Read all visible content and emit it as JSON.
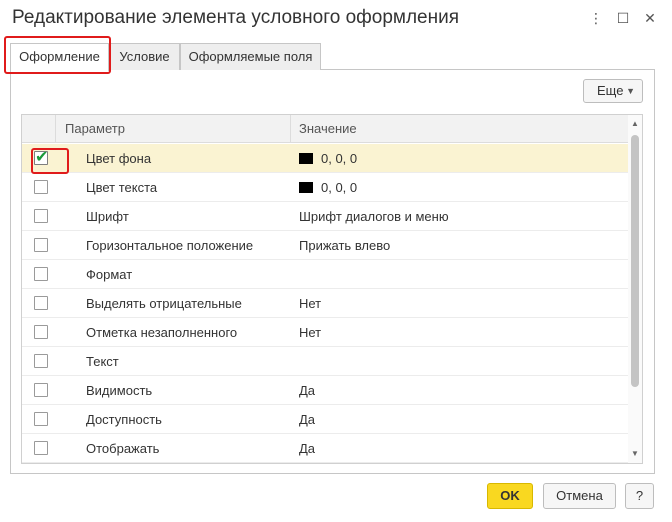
{
  "window": {
    "title": "Редактирование элемента условного оформления",
    "more_icon": "⋮",
    "maximize_icon": "☐",
    "close_icon": "✕"
  },
  "tabs": [
    {
      "label": "Оформление",
      "active": true
    },
    {
      "label": "Условие",
      "active": false
    },
    {
      "label": "Оформляемые поля",
      "active": false
    }
  ],
  "toolbar": {
    "more_label": "Еще",
    "more_caret": "▼"
  },
  "grid": {
    "columns": {
      "parameter": "Параметр",
      "value": "Значение"
    },
    "rows": [
      {
        "checked": true,
        "name": "Цвет фона",
        "value": "0, 0, 0",
        "swatch": "#000000"
      },
      {
        "checked": false,
        "name": "Цвет текста",
        "value": "0, 0, 0",
        "swatch": "#000000"
      },
      {
        "checked": false,
        "name": "Шрифт",
        "value": "Шрифт диалогов и меню"
      },
      {
        "checked": false,
        "name": "Горизонтальное положение",
        "value": "Прижать влево"
      },
      {
        "checked": false,
        "name": "Формат",
        "value": ""
      },
      {
        "checked": false,
        "name": "Выделять отрицательные",
        "value": "Нет"
      },
      {
        "checked": false,
        "name": "Отметка незаполненного",
        "value": "Нет"
      },
      {
        "checked": false,
        "name": "Текст",
        "value": ""
      },
      {
        "checked": false,
        "name": "Видимость",
        "value": "Да"
      },
      {
        "checked": false,
        "name": "Доступность",
        "value": "Да"
      },
      {
        "checked": false,
        "name": "Отображать",
        "value": "Да"
      }
    ],
    "check_glyph": "✔",
    "scroll_up_glyph": "▲",
    "scroll_down_glyph": "▼"
  },
  "footer": {
    "ok_label": "OK",
    "cancel_label": "Отмена",
    "help_label": "?"
  },
  "colors": {
    "ok_button": "#f9d820",
    "highlight": "#e01b1b",
    "selected_row": "#faf3d2",
    "check": "#1b9a3a"
  }
}
